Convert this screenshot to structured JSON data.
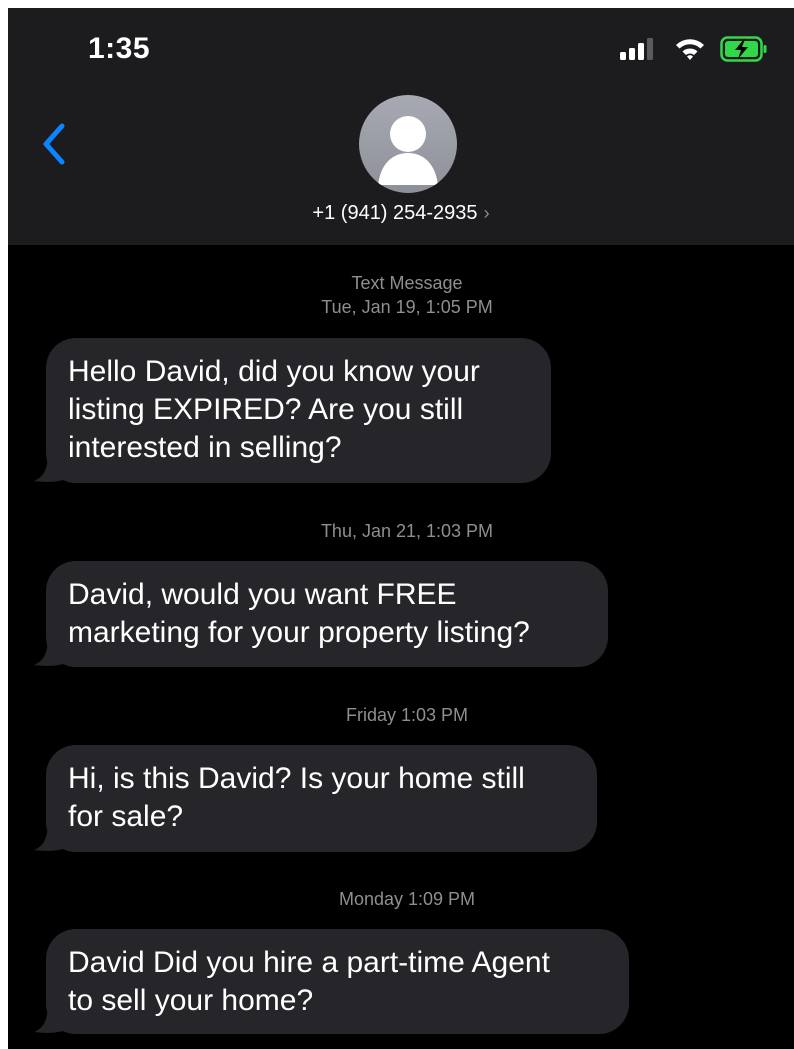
{
  "status_bar": {
    "time": "1:35",
    "icons": [
      "cellular-signal-icon",
      "wifi-icon",
      "battery-charging-icon"
    ]
  },
  "header": {
    "contact_number": "+1 (941) 254-2935",
    "chevron": "›"
  },
  "conversation": {
    "type_label": "Text Message",
    "timestamps": [
      "Tue, Jan 19, 1:05 PM",
      "Thu, Jan 21, 1:03 PM",
      "Friday 1:03 PM",
      "Monday 1:09 PM"
    ],
    "messages": [
      {
        "lines": [
          "Hello David, did you know your",
          "listing EXPIRED? Are you still",
          "interested in selling?"
        ]
      },
      {
        "lines": [
          "David,  would you want FREE",
          "marketing for your property listing?"
        ]
      },
      {
        "lines": [
          "Hi, is this David? Is your home still",
          "for sale?"
        ]
      },
      {
        "lines": [
          "David Did you hire a part-time Agent",
          "to sell your home?"
        ]
      }
    ]
  },
  "colors": {
    "background": "#000000",
    "header_background": "#1c1c1e",
    "bubble": "#26252a",
    "accent_blue": "#0a84ff",
    "timestamp_gray": "#8e8e93",
    "battery_green": "#32d74b"
  }
}
